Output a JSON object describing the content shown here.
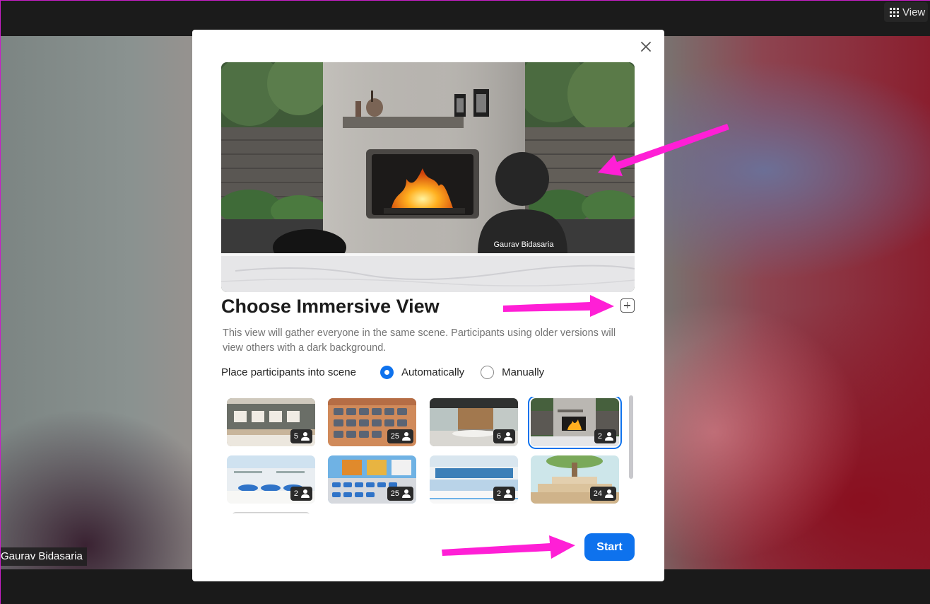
{
  "topbar": {
    "view_label": "View"
  },
  "video": {
    "participant_name": "Gaurav Bidasaria"
  },
  "modal": {
    "preview_name_tag": "Gaurav Bidasaria",
    "title": "Choose Immersive View",
    "description": "This view will gather everyone in the same scene. Participants using older versions will view others with a dark background.",
    "place_label": "Place participants into scene",
    "options": [
      {
        "label": "Automatically",
        "selected": true
      },
      {
        "label": "Manually",
        "selected": false
      }
    ],
    "scenes": [
      {
        "name": "gallery-wall",
        "count": "5",
        "selected": false
      },
      {
        "name": "auditorium",
        "count": "25",
        "selected": false
      },
      {
        "name": "office-lounge",
        "count": "6",
        "selected": false
      },
      {
        "name": "fireplace",
        "count": "2",
        "selected": true
      },
      {
        "name": "kitchen-counter",
        "count": "2",
        "selected": false
      },
      {
        "name": "classroom",
        "count": "25",
        "selected": false
      },
      {
        "name": "cafe",
        "count": "2",
        "selected": false
      },
      {
        "name": "treehouse",
        "count": "24",
        "selected": false
      }
    ],
    "start_label": "Start"
  },
  "colors": {
    "accent": "#0e72ed",
    "annotation_arrow": "#ff1fd6"
  },
  "icons": [
    "grid-icon",
    "close-icon",
    "plus-square-icon",
    "person-icon"
  ]
}
